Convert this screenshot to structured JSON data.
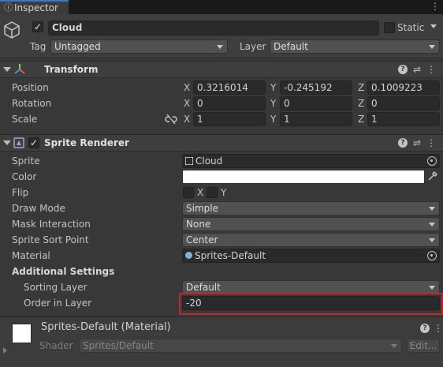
{
  "tab": {
    "icon": "info-icon",
    "label": "Inspector",
    "menu_icon": "kebab-menu-icon"
  },
  "gameobject": {
    "icon": "cube-icon",
    "active": true,
    "name": "Cloud",
    "static_label": "Static",
    "static_checked": false,
    "tag_label": "Tag",
    "tag_value": "Untagged",
    "layer_label": "Layer",
    "layer_value": "Default"
  },
  "transform": {
    "title": "Transform",
    "icon": "transform-axes-icon",
    "position_label": "Position",
    "rotation_label": "Rotation",
    "scale_label": "Scale",
    "axis_x": "X",
    "axis_y": "Y",
    "axis_z": "Z",
    "position": {
      "x": "0.3216014",
      "y": "-0.245192",
      "z": "0.1009223"
    },
    "rotation": {
      "x": "0",
      "y": "0",
      "z": "0"
    },
    "scale": {
      "x": "1",
      "y": "1",
      "z": "1"
    },
    "scale_link_icon": "link-broken-icon"
  },
  "sprite_renderer": {
    "title": "Sprite Renderer",
    "enabled": true,
    "sprite_label": "Sprite",
    "sprite_value": "Cloud",
    "color_label": "Color",
    "color_value": "#ffffff",
    "flip_label": "Flip",
    "flip_x": "X",
    "flip_y": "Y",
    "draw_mode_label": "Draw Mode",
    "draw_mode_value": "Simple",
    "mask_label": "Mask Interaction",
    "mask_value": "None",
    "sort_point_label": "Sprite Sort Point",
    "sort_point_value": "Center",
    "material_label": "Material",
    "material_value": "Sprites-Default",
    "additional_label": "Additional Settings",
    "sorting_layer_label": "Sorting Layer",
    "sorting_layer_value": "Default",
    "order_label": "Order in Layer",
    "order_value": "-20",
    "highlight_color": "#c0282b"
  },
  "material_panel": {
    "title": "Sprites-Default (Material)",
    "shader_label": "Shader",
    "shader_value": "Sprites/Default",
    "edit_label": "Edit..."
  }
}
